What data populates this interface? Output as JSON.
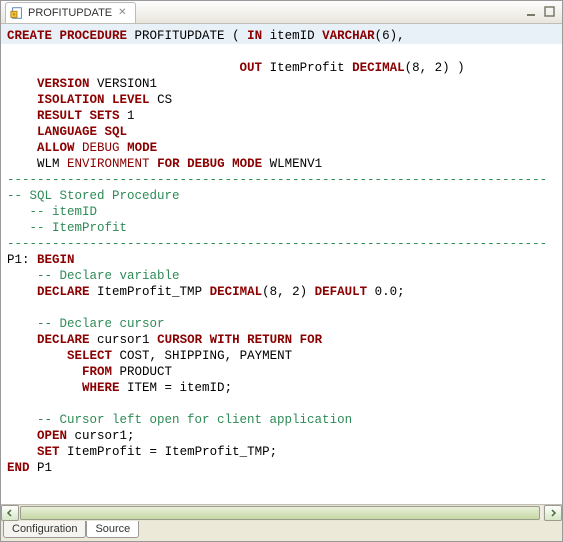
{
  "titlebar": {
    "icon": "sql-proc-icon",
    "title": "PROFITUPDATE",
    "close_glyph": "✕"
  },
  "sep_line": "------------------------------------------------------------------------",
  "code": {
    "l1a": "CREATE PROCEDURE",
    "l1b": "PROFITUPDATE (",
    "l1c": "IN",
    "l1d": "itemID",
    "l1e": "VARCHAR",
    "l1f": "(6),",
    "l2a": "OUT",
    "l2b": "ItemProfit",
    "l2c": "DECIMAL",
    "l2d": "(8, 2) )",
    "l3a": "VERSION",
    "l3b": "VERSION1",
    "l4a": "ISOLATION LEVEL",
    "l4b": "CS",
    "l5a": "RESULT SETS",
    "l5b": "1",
    "l6a": "LANGUAGE SQL",
    "l7a": "ALLOW",
    "l7b": "DEBUG",
    "l7c": "MODE",
    "l8a": "WLM",
    "l8b": "ENVIRONMENT",
    "l8c": "FOR DEBUG MODE",
    "l8d": "WLMENV1",
    "c1": "-- SQL Stored Procedure",
    "c2": "-- itemID",
    "c3": "-- ItemProfit",
    "l9a": "P1:",
    "l9b": "BEGIN",
    "c4": "-- Declare variable",
    "l10a": "DECLARE",
    "l10b": "ItemProfit_TMP",
    "l10c": "DECIMAL",
    "l10d": "(8, 2)",
    "l10e": "DEFAULT",
    "l10f": "0.0;",
    "c5": "-- Declare cursor",
    "l11a": "DECLARE",
    "l11b": "cursor1",
    "l11c": "CURSOR WITH RETURN FOR",
    "l12a": "SELECT",
    "l12b": "COST, SHIPPING, PAYMENT",
    "l13a": "FROM",
    "l13b": "PRODUCT",
    "l14a": "WHERE",
    "l14b": "ITEM = itemID;",
    "c6": "-- Cursor left open for client application",
    "l15a": "OPEN",
    "l15b": "cursor1;",
    "l16a": "SET",
    "l16b": "ItemProfit = ItemProfit_TMP;",
    "l17a": "END",
    "l17b": "P1"
  },
  "bottom_tabs": {
    "config": "Configuration",
    "source": "Source"
  }
}
